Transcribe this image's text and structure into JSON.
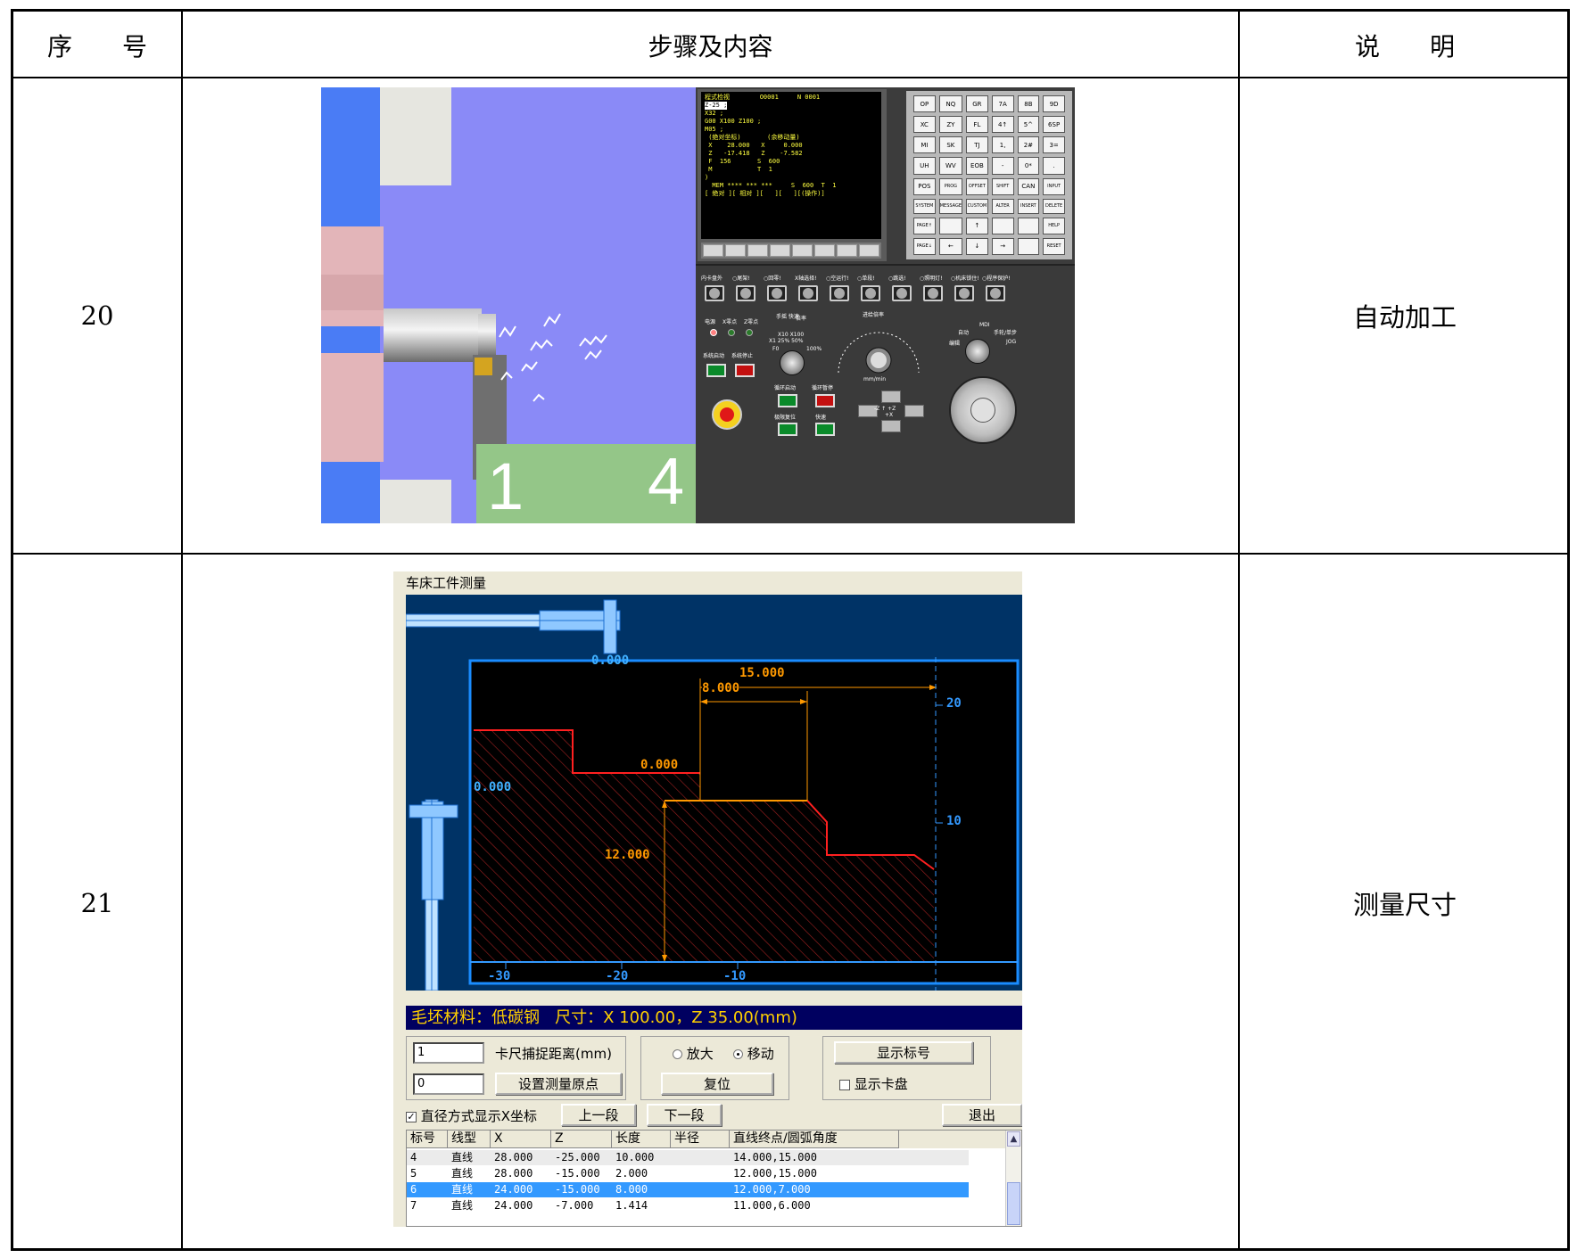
{
  "table": {
    "headers": {
      "seq": "序　　号",
      "steps": "步骤及内容",
      "note": "说　　明"
    },
    "rows": [
      {
        "seq": "20",
        "note": "自动加工"
      },
      {
        "seq": "21",
        "note": "测量尺寸"
      }
    ]
  },
  "cnc_sim": {
    "scene_digits": [
      "1",
      "4"
    ],
    "screen_lines": [
      "程式检视        O0001     N 0001",
      "Z-25 ;",
      "X32 ;",
      "G00 X100 Z100 ;",
      "M05 ;",
      " (绝对坐标)       (余移动量)",
      " X    28.000   X     0.000",
      " Z   -17.418   Z    -7.582",
      "",
      " F  156       S  600",
      " M            T  1",
      "",
      "",
      ")",
      "  MEM **** *** ***     S  600  T  1",
      "[ 绝对 ][ 相对 ][   ][   ][(操作)]"
    ],
    "keypad_keys": [
      "OP",
      "NQ",
      "GR",
      "7A",
      "8B",
      "9D",
      "XC",
      "ZY",
      "FL",
      "4↑",
      "5^",
      "6SP",
      "MI",
      "SK",
      "TJ",
      "1,",
      "2#",
      "3=",
      "UH",
      "WV",
      "EOB",
      "-",
      "0*",
      ".",
      "POS",
      "PROG",
      "OFFSET",
      "SHIFT",
      "CAN",
      "INPUT",
      "SYSTEM",
      "MESSAGE",
      "CUSTOM",
      "ALTER",
      "INSERT",
      "DELETE",
      "PAGE↑",
      "",
      "↑",
      "",
      "",
      "HELP",
      "PAGE↓",
      "←",
      "↓",
      "→",
      "",
      "RESET"
    ],
    "panel_labels": {
      "top_switches": [
        "内卡盘外",
        "○尾架!",
        "○回零!",
        "X轴选择!",
        "○空运行!",
        "○单段!",
        "○跳选!",
        "○照明灯!",
        "○机床锁住!",
        "○程序保护!"
      ],
      "power": "电源",
      "x_zero": "X零点",
      "z_zero": "Z零点",
      "sys_start": "系统启动",
      "sys_stop": "系统停止",
      "hand_rapid": "手摇 快速",
      "rate": "倍率",
      "rate_values": "X10  X100",
      "rate_values2": "X1  25%  50%",
      "f0": "F0",
      "pct100": "100%",
      "feed_rate": "进给倍率",
      "feed_unit": "mm/min",
      "auto": "自动",
      "mdi": "MDI",
      "hand_step": "手轮/单步",
      "edit": "编辑",
      "jog": "JOG",
      "cycle_start": "循环启动",
      "cycle_pause": "循环暂停",
      "limit_reset": "极限复位",
      "rapid": "快速",
      "jog_axes": "-Z  ↑  +Z",
      "jog_axes2": "+X"
    }
  },
  "measure": {
    "window_title": "车床工件测量",
    "caliper_reading_top": "0.000",
    "caliper_reading_left": "0.000",
    "dims": {
      "d15": "15.000",
      "d8": "8.000",
      "d0": "0.000",
      "d12": "12.000"
    },
    "z_ticks": [
      "-30",
      "-20",
      "-10"
    ],
    "x_ticks": [
      "20",
      "10"
    ],
    "info_bar": "毛坯材料：低碳钢   尺寸：X 100.00，Z 35.00(mm)",
    "capture_value": "1",
    "capture_label": "卡尺捕捉距离(mm)",
    "origin_value": "0",
    "set_origin_label": "设置测量原点",
    "zoom_label": "放大",
    "move_label": "移动",
    "reset_label": "复位",
    "show_marks_label": "显示标号",
    "show_chuck_label": "显示卡盘",
    "diameter_label": "直径方式显示X坐标",
    "prev_label": "上一段",
    "next_label": "下一段",
    "exit_label": "退出",
    "list_headers": [
      "标号",
      "线型",
      "X",
      "Z",
      "长度",
      "半径",
      "直线终点/圆弧角度"
    ],
    "list_rows": [
      [
        "4",
        "直线",
        "28.000",
        "-25.000",
        "10.000",
        "",
        "14.000,15.000"
      ],
      [
        "5",
        "直线",
        "28.000",
        "-15.000",
        "2.000",
        "",
        "12.000,15.000"
      ],
      [
        "6",
        "直线",
        "24.000",
        "-15.000",
        "8.000",
        "",
        "12.000,7.000"
      ],
      [
        "7",
        "直线",
        "24.000",
        "-7.000",
        "1.414",
        "",
        "11.000,6.000"
      ]
    ],
    "colors": {
      "dim": "#ff9900",
      "profile": "#ff2020",
      "axis": "#3399ff",
      "frame": "#1a8cff"
    }
  }
}
